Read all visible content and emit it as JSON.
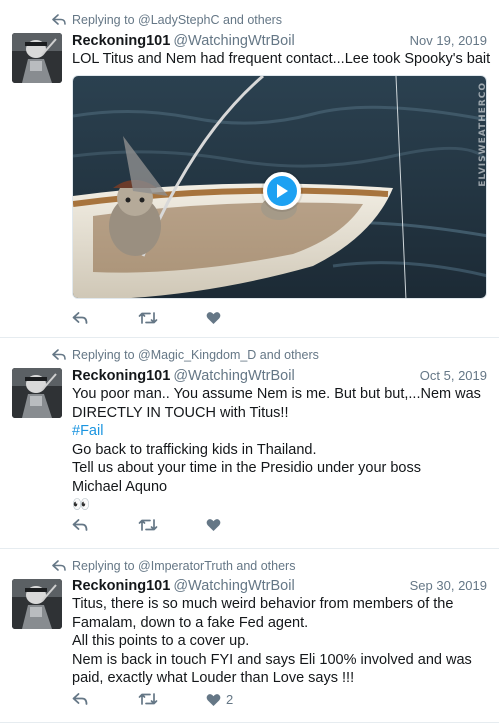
{
  "tweets": [
    {
      "reply_prefix": "Replying to",
      "reply_to": "@LadyStephC and others",
      "name": "Reckoning101",
      "handle": "@WatchingWtrBoil",
      "date": "Nov 19, 2019",
      "lines": [
        "LOL  Titus and Nem had frequent contact...Lee took Spooky's bait"
      ],
      "media": {
        "watermark": "ELVISWEATHERCO"
      },
      "like_count": ""
    },
    {
      "reply_prefix": "Replying to",
      "reply_to": "@Magic_Kingdom_D and others",
      "name": "Reckoning101",
      "handle": "@WatchingWtrBoil",
      "date": "Oct 5, 2019",
      "lines": [
        "You poor man.. You assume Nem is me. But but but,...Nem was",
        "DIRECTLY IN TOUCH with Titus!!",
        "#Fail",
        "Go back to trafficking kids in Thailand.",
        "Tell us about your time in the Presidio under your boss",
        "Michael Aquno",
        "👀"
      ],
      "like_count": ""
    },
    {
      "reply_prefix": "Replying to",
      "reply_to": "@ImperatorTruth and others",
      "name": "Reckoning101",
      "handle": "@WatchingWtrBoil",
      "date": "Sep 30, 2019",
      "lines": [
        "Titus, there is so much weird behavior from members of the",
        "Famalam, down to a fake Fed agent.",
        "All this points to a cover up.",
        "Nem is back in touch FYI and says Eli 100% involved and was",
        "paid, exactly what Louder than Love says !!!"
      ],
      "like_count": "2"
    }
  ],
  "icons": {
    "reply": "reply-icon",
    "retweet": "retweet-icon",
    "like": "heart-icon",
    "replying": "reply-arrow-icon",
    "play": "play-icon"
  },
  "colors": {
    "text": "#14171a",
    "muted": "#657786",
    "link": "#1b95e0",
    "accent": "#1da1f2",
    "divider": "#e6ecf0"
  }
}
